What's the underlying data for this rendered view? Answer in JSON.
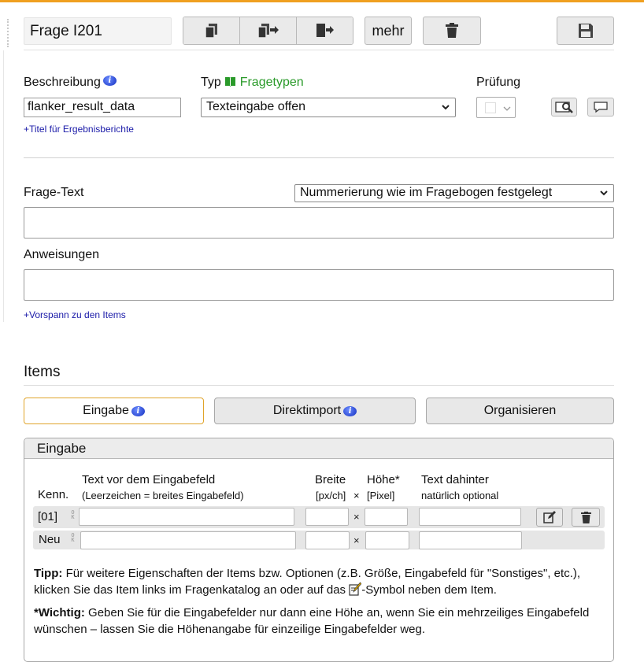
{
  "header": {
    "title": "Frage I201",
    "more_label": "mehr",
    "buttons": [
      "copy-icon",
      "copy-to-icon",
      "move-icon",
      "trash-icon",
      "save-icon"
    ]
  },
  "description": {
    "label": "Beschreibung",
    "value": "flanker_result_data",
    "title_link": "+Titel für Ergebnisberichte"
  },
  "type": {
    "label": "Typ",
    "link": "Fragetypen",
    "selected": "Texteingabe offen"
  },
  "check": {
    "label": "Prüfung"
  },
  "question_text": {
    "label": "Frage-Text",
    "numbering_selected": "Nummerierung wie im Fragebogen festgelegt",
    "value": ""
  },
  "instructions": {
    "label": "Anweisungen",
    "value": "",
    "intro_link": "+Vorspann zu den Items"
  },
  "items": {
    "heading": "Items",
    "tabs": [
      {
        "label": "Eingabe",
        "active": true
      },
      {
        "label": "Direktimport",
        "active": false
      },
      {
        "label": "Organisieren",
        "active": false
      }
    ],
    "panel_title": "Eingabe",
    "columns": {
      "id": "Kenn.",
      "text_before": "Text vor dem Eingabefeld",
      "text_before_hint": "(Leerzeichen = breites Eingabefeld)",
      "width": "Breite",
      "width_unit": "[px/ch]",
      "times": "×",
      "height": "Höhe*",
      "height_unit": "[Pixel]",
      "text_after": "Text dahinter",
      "text_after_hint": "natürlich optional"
    },
    "rows": [
      {
        "id": "[01]",
        "times": "×"
      },
      {
        "id": "Neu",
        "times": "×"
      }
    ],
    "tip_label": "Tipp:",
    "tip_text_1": "Für weitere Eigenschaften der Items bzw. Optionen (z.B. Größe, Eingabefeld für \"Sonstiges\", etc.), klicken Sie das Item links im Fragenkatalog an oder auf das",
    "tip_text_2": "-Symbol neben dem Item.",
    "important_label": "*Wichtig:",
    "important_text": "Geben Sie für die Eingabefelder nur dann eine Höhe an, wenn Sie ein mehrzeiliges Eingabefeld wünschen – lassen Sie die Höhenangabe für einzeilige Eingabefelder weg."
  },
  "colors": {
    "accent": "#f0a020",
    "link": "#1a1aa8",
    "green": "#2a9a2a"
  }
}
